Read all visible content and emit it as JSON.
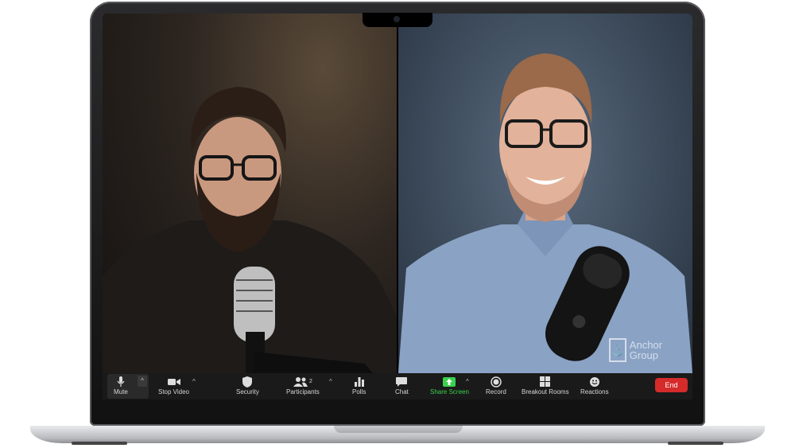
{
  "toolbar": {
    "mute": "Mute",
    "stop_video": "Stop Video",
    "security": "Security",
    "participants": "Participants",
    "participants_count": "2",
    "polls": "Polls",
    "chat": "Chat",
    "share_screen": "Share Screen",
    "record": "Record",
    "breakout_rooms": "Breakout Rooms",
    "reactions": "Reactions",
    "end": "End"
  },
  "logo": {
    "line1": "Anchor",
    "line2": "Group"
  },
  "colors": {
    "toolbar_bg": "#1a1a1a",
    "end_red": "#d52b2b",
    "share_green": "#39d04d"
  }
}
